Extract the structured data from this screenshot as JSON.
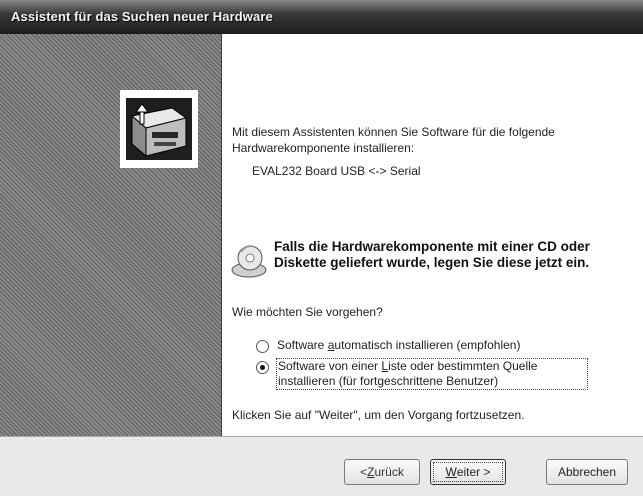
{
  "window": {
    "title": "Assistent für das Suchen neuer Hardware"
  },
  "content": {
    "intro": "Mit diesem Assistenten können Sie Software für die folgende Hardwarekomponente installieren:",
    "device_name": "EVAL232 Board USB <-> Serial",
    "cd_prompt": "Falls die Hardwarekomponente mit einer CD oder Diskette geliefert wurde, legen Sie diese jetzt ein.",
    "question": "Wie möchten Sie vorgehen?",
    "options": [
      {
        "pre": "Software ",
        "accel": "a",
        "post": "utomatisch installieren (empfohlen)",
        "selected": false
      },
      {
        "pre": "Software von einer ",
        "accel": "L",
        "post": "iste oder bestimmten Quelle installieren (für fortgeschrittene Benutzer)",
        "selected": true
      }
    ],
    "hint": "Klicken Sie auf \"Weiter\", um den Vorgang fortzusetzen."
  },
  "buttons": {
    "back": {
      "pre": "< ",
      "accel": "Z",
      "post": "urück"
    },
    "next": {
      "pre": "",
      "accel": "W",
      "post": "eiter >"
    },
    "cancel": "Abbrechen"
  },
  "icons": {
    "wizard": "hardware-wizard-icon",
    "cd": "cd-disk-icon"
  }
}
